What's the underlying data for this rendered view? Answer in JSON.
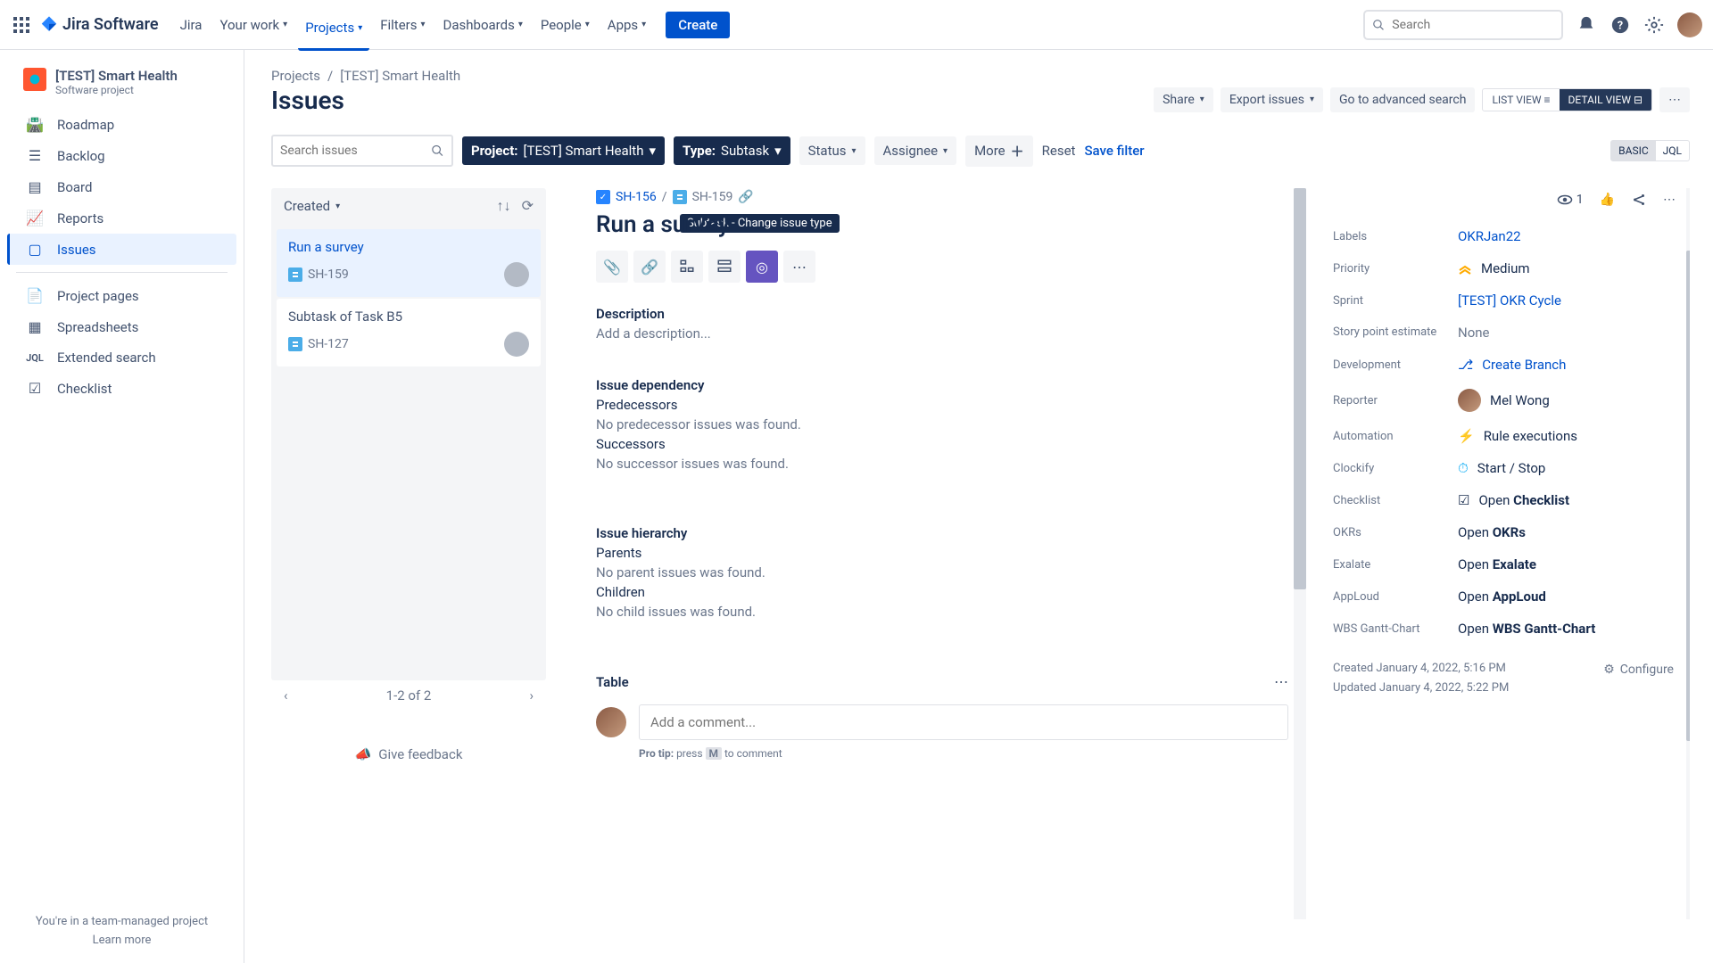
{
  "topnav": {
    "product": "Jira Software",
    "jira": "Jira",
    "links": [
      "Your work",
      "Projects",
      "Filters",
      "Dashboards",
      "People",
      "Apps"
    ],
    "create": "Create",
    "search_ph": "Search"
  },
  "sidebar": {
    "project_name": "[TEST] Smart Health",
    "project_sub": "Software project",
    "items": [
      "Roadmap",
      "Backlog",
      "Board",
      "Reports",
      "Issues",
      "Project pages",
      "Spreadsheets",
      "Extended search",
      "Checklist"
    ],
    "footer1": "You're in a team-managed project",
    "footer2": "Learn more"
  },
  "breadcrumb": {
    "a": "Projects",
    "b": "[TEST] Smart Health"
  },
  "page_title": "Issues",
  "actions": {
    "share": "Share",
    "export": "Export issues",
    "adv": "Go to advanced search",
    "list": "LIST VIEW",
    "detail": "DETAIL VIEW"
  },
  "filters": {
    "search_ph": "Search issues",
    "project_lab": "Project:",
    "project_val": "[TEST] Smart Health",
    "type_lab": "Type:",
    "type_val": "Subtask",
    "status": "Status",
    "assignee": "Assignee",
    "more": "More",
    "reset": "Reset",
    "save": "Save filter",
    "basic": "BASIC",
    "jql": "JQL"
  },
  "tooltip": "Subtask - Change issue type",
  "list": {
    "sort": "Created",
    "items": [
      {
        "title": "Run a survey",
        "key": "SH-159"
      },
      {
        "title": "Subtask of Task B5",
        "key": "SH-127"
      }
    ],
    "pager": "1-2 of 2",
    "feedback": "Give feedback"
  },
  "issue": {
    "parent_key": "SH-156",
    "key": "SH-159",
    "title": "Run a survey",
    "desc_h": "Description",
    "desc_ph": "Add a description...",
    "dep_h": "Issue dependency",
    "pred": "Predecessors",
    "pred_none": "No predecessor issues was found.",
    "succ": "Successors",
    "succ_none": "No successor issues was found.",
    "hier_h": "Issue hierarchy",
    "parents": "Parents",
    "parents_none": "No parent issues was found.",
    "children": "Children",
    "children_none": "No child issues was found.",
    "table_h": "Table",
    "comment_ph": "Add a comment...",
    "protip_pre": "Pro tip:",
    "protip_mid": "press",
    "protip_key": "M",
    "protip_end": "to comment",
    "watch": "1"
  },
  "rs": {
    "labels_l": "Labels",
    "labels_v": "OKRJan22",
    "prio_l": "Priority",
    "prio_v": "Medium",
    "sprint_l": "Sprint",
    "sprint_v": "[TEST] OKR Cycle",
    "sp_l": "Story point estimate",
    "sp_v": "None",
    "dev_l": "Development",
    "dev_v": "Create Branch",
    "rep_l": "Reporter",
    "rep_v": "Mel Wong",
    "auto_l": "Automation",
    "auto_v": "Rule executions",
    "clock_l": "Clockify",
    "clock_v": "Start / Stop",
    "check_l": "Checklist",
    "check_pre": "Open ",
    "check_bold": "Checklist",
    "okr_l": "OKRs",
    "okr_pre": "Open ",
    "okr_bold": "OKRs",
    "ex_l": "Exalate",
    "ex_pre": "Open ",
    "ex_bold": "Exalate",
    "app_l": "AppLoud",
    "app_pre": "Open ",
    "app_bold": "AppLoud",
    "wbs_l": "WBS Gantt-Chart",
    "wbs_pre": "Open ",
    "wbs_bold": "WBS Gantt-Chart",
    "created": "Created January 4, 2022, 5:16 PM",
    "updated": "Updated January 4, 2022, 5:22 PM",
    "configure": "Configure"
  }
}
